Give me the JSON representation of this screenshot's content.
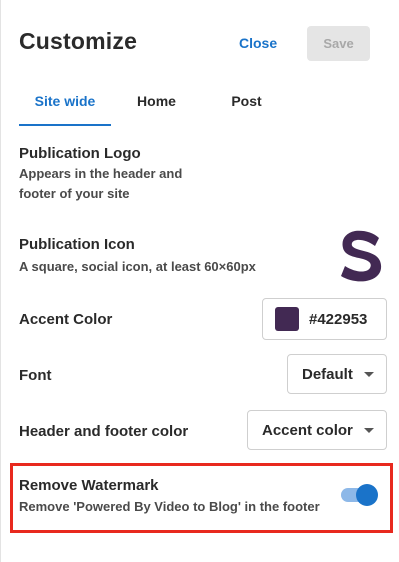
{
  "header": {
    "title": "Customize",
    "close_label": "Close",
    "save_label": "Save"
  },
  "tabs": [
    {
      "label": "Site wide",
      "active": true
    },
    {
      "label": "Home",
      "active": false
    },
    {
      "label": "Post",
      "active": false
    }
  ],
  "publication_logo": {
    "title": "Publication Logo",
    "desc_line1": "Appears in the header and",
    "desc_line2": "footer of your site"
  },
  "publication_icon": {
    "title": "Publication Icon",
    "desc": "A square, social icon, at least 60×60px",
    "icon": "s-logo-icon",
    "icon_color": "#422953"
  },
  "accent_color": {
    "title": "Accent Color",
    "value": "#422953"
  },
  "font": {
    "title": "Font",
    "value": "Default"
  },
  "header_footer_color": {
    "title": "Header and footer color",
    "value": "Accent color"
  },
  "remove_watermark": {
    "title": "Remove Watermark",
    "desc": "Remove 'Powered By Video to Blog' in the footer",
    "enabled": true,
    "highlight_color": "#e8291e"
  },
  "colors": {
    "accent_blue": "#1a73c9"
  }
}
